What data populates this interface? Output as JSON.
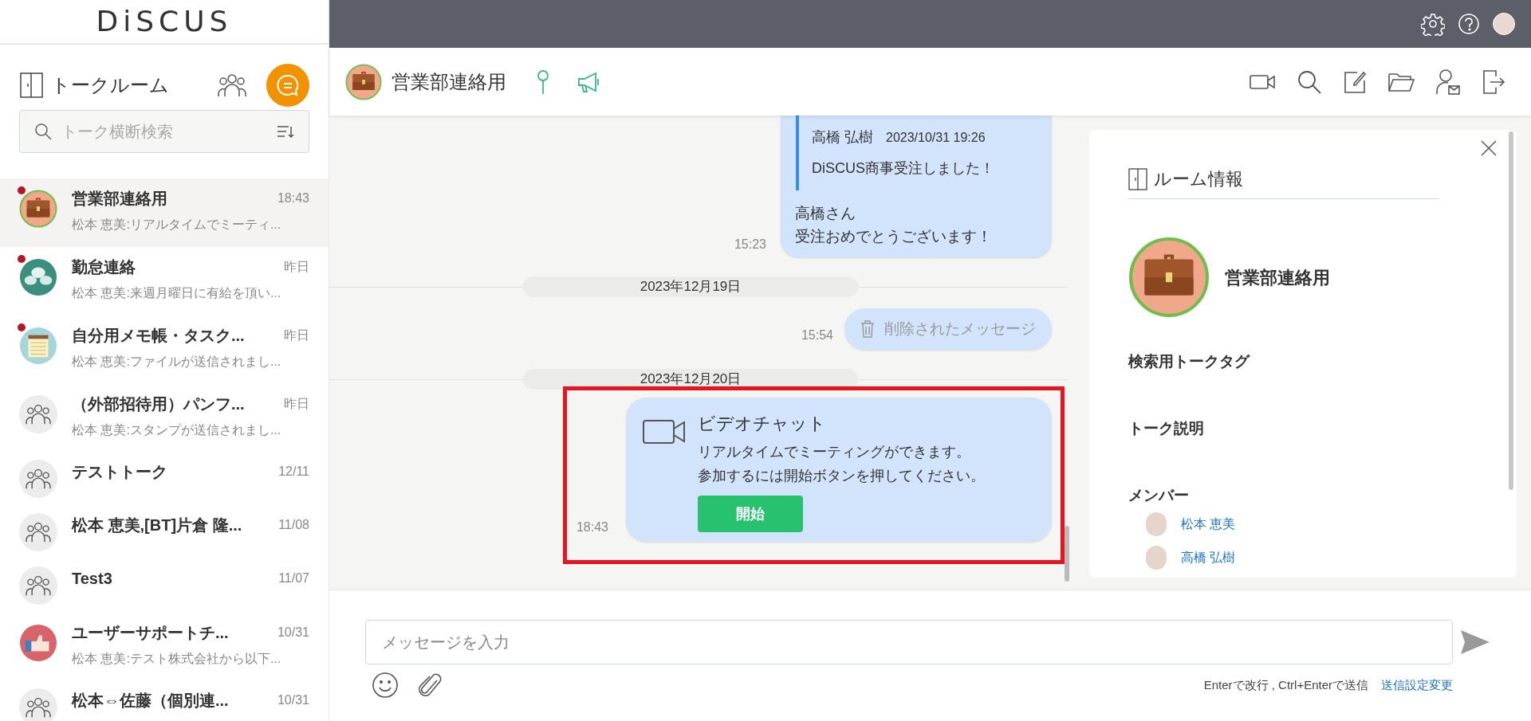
{
  "logo": "DiSCUS",
  "sidebar": {
    "title": "トークルーム",
    "search": {
      "placeholder": "トーク横断検索"
    },
    "rooms": [
      {
        "name": "営業部連絡用",
        "time": "18:43",
        "preview": "松本 恵美:リアルタイムでミーティ...",
        "kind": "briefcase",
        "unread": true,
        "selected": true
      },
      {
        "name": "勤怠連絡",
        "time": "昨日",
        "preview": "松本 恵美:来週月曜日に有給を頂い...",
        "kind": "chat",
        "unread": true,
        "selected": false
      },
      {
        "name": "自分用メモ帳・タスク...",
        "time": "昨日",
        "preview": "松本 恵美:ファイルが送信されまし...",
        "kind": "notepad",
        "unread": true,
        "selected": false
      },
      {
        "name": "（外部招待用）パンフ...",
        "time": "昨日",
        "preview": "松本 恵美:スタンプが送信されまし...",
        "kind": "group",
        "unread": false,
        "selected": false
      },
      {
        "name": "テストトーク",
        "time": "12/11",
        "kind": "group",
        "unread": false,
        "selected": false
      },
      {
        "name": "松本 恵美,[BT]片倉 隆...",
        "time": "11/08",
        "kind": "group",
        "unread": false,
        "selected": false
      },
      {
        "name": "Test3",
        "time": "11/07",
        "kind": "group",
        "unread": false,
        "selected": false
      },
      {
        "name": "ユーザーサポートチ...",
        "time": "10/31",
        "preview": "松本 恵美:テスト株式会社から以下...",
        "kind": "thumbs",
        "unread": false,
        "selected": false
      },
      {
        "name": "松本⇔佐藤（個別連...",
        "time": "10/31",
        "kind": "group",
        "unread": false,
        "selected": false
      }
    ]
  },
  "room_header": {
    "title": "営業部連絡用"
  },
  "messages": [
    {
      "kind": "reply",
      "quote_author": "高橋 弘樹",
      "quote_time": "2023/10/31 19:26",
      "quote_text": "DiSCUS商事受注しました！",
      "lines": [
        "高橋さん",
        "受注おめでとうございます！"
      ],
      "time": "15:23"
    },
    {
      "kind": "date",
      "text": "2023年12月19日"
    },
    {
      "kind": "deleted",
      "text": "削除されたメッセージ",
      "time": "15:54"
    },
    {
      "kind": "date",
      "text": "2023年12月20日"
    },
    {
      "kind": "video",
      "title": "ビデオチャット",
      "lines": [
        "リアルタイムでミーティングができます。",
        "参加するには開始ボタンを押してください。"
      ],
      "button": "開始",
      "time": "18:43",
      "highlighted": true
    }
  ],
  "room_info": {
    "title": "ルーム情報",
    "name": "営業部連絡用",
    "sections": [
      "検索用トークタグ",
      "トーク説明",
      "メンバー"
    ],
    "members": [
      "松本 恵美",
      "高橋 弘樹"
    ]
  },
  "composer": {
    "placeholder": "メッセージを入力",
    "hint": "Enterで改行 , Ctrl+Enterで送信",
    "settings_link": "送信設定変更"
  }
}
